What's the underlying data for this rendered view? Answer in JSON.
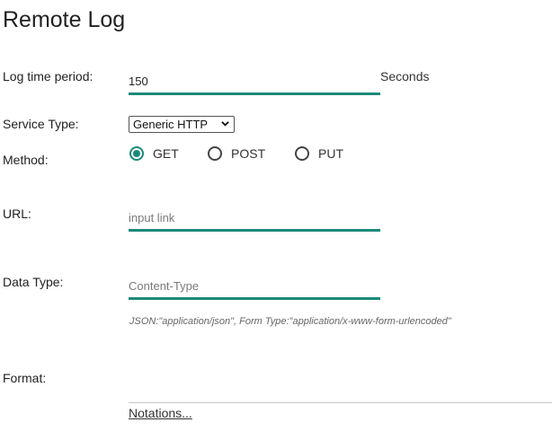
{
  "page": {
    "title": "Remote Log"
  },
  "log_time_period": {
    "label": "Log time period:",
    "value": "150",
    "unit": "Seconds"
  },
  "service_type": {
    "label": "Service Type:",
    "selected": "Generic HTTP"
  },
  "method": {
    "label": "Method:",
    "options": [
      "GET",
      "POST",
      "PUT"
    ],
    "selected": "GET"
  },
  "url": {
    "label": "URL:",
    "placeholder": "input link"
  },
  "data_type": {
    "label": "Data Type:",
    "placeholder": "Content-Type",
    "hint": "JSON:\"application/json\", Form Type:\"application/x-www-form-urlencoded\""
  },
  "format": {
    "label": "Format:",
    "notations_link": "Notations..."
  },
  "colors": {
    "accent": "#1b8a7a"
  }
}
